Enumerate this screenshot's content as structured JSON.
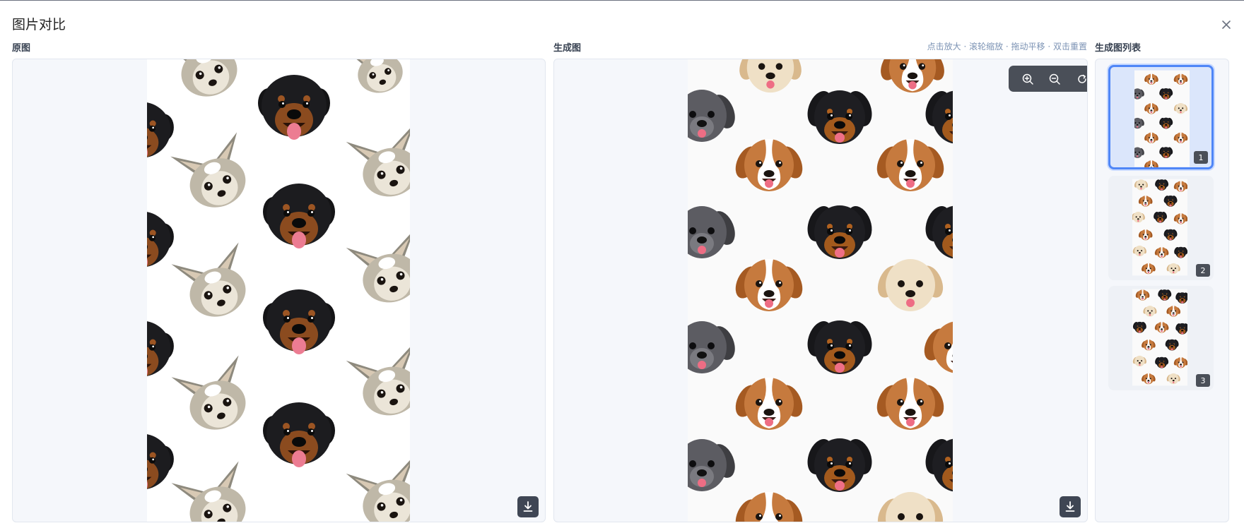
{
  "dialog": {
    "title": "图片对比"
  },
  "original": {
    "label": "原图"
  },
  "generated": {
    "label": "生成图",
    "hint": "点击放大 · 滚轮缩放 · 拖动平移 · 双击重置"
  },
  "zoom_toolbar": {
    "icons": [
      "zoom-in-icon",
      "zoom-out-icon",
      "reset-icon"
    ]
  },
  "thumbnail_list": {
    "label": "生成图列表",
    "items": [
      {
        "number": "1",
        "selected": true
      },
      {
        "number": "2",
        "selected": false
      },
      {
        "number": "3",
        "selected": false
      }
    ]
  },
  "colors": {
    "accent": "#4f86f7",
    "panel_bg": "#f5f7fb",
    "button_bg": "#3f4654",
    "hint": "#7c93b4"
  }
}
